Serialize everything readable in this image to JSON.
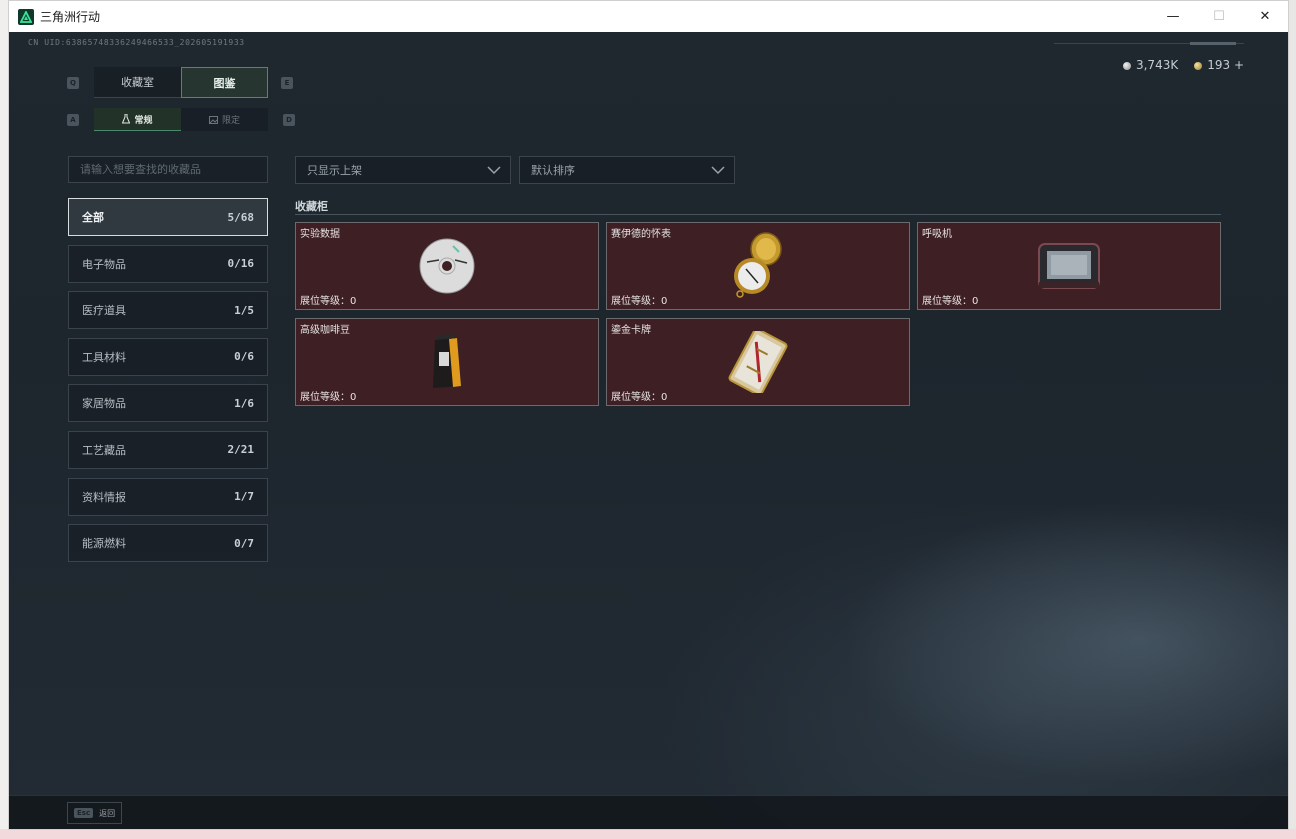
{
  "window": {
    "title": "三角洲行动",
    "minimize_glyph": "—",
    "maximize_glyph": "☐",
    "close_glyph": "✕"
  },
  "header": {
    "uid": "CN UID:63865748336249466533_202605191933",
    "silver_amount": "3,743K",
    "gold_amount": "193 +"
  },
  "tabs": {
    "prev_key": "Q",
    "next_key": "E",
    "items": [
      {
        "label": "收藏室",
        "active": false
      },
      {
        "label": "图鉴",
        "active": true
      }
    ]
  },
  "subtabs": {
    "prev_key": "A",
    "next_key": "D",
    "items": [
      {
        "label": "常规",
        "icon": "flask-icon",
        "active": true
      },
      {
        "label": "限定",
        "icon": "image-icon",
        "active": false
      }
    ]
  },
  "search": {
    "placeholder": "请输入想要查找的收藏品"
  },
  "categories": [
    {
      "label": "全部",
      "count": "5/68",
      "active": true
    },
    {
      "label": "电子物品",
      "count": "0/16",
      "active": false
    },
    {
      "label": "医疗道具",
      "count": "1/5",
      "active": false
    },
    {
      "label": "工具材料",
      "count": "0/6",
      "active": false
    },
    {
      "label": "家居物品",
      "count": "1/6",
      "active": false
    },
    {
      "label": "工艺藏品",
      "count": "2/21",
      "active": false
    },
    {
      "label": "资料情报",
      "count": "1/7",
      "active": false
    },
    {
      "label": "能源燃料",
      "count": "0/7",
      "active": false
    }
  ],
  "filters": {
    "shelf_filter": "只显示上架",
    "sort": "默认排序"
  },
  "cabinet": {
    "title": "收藏柜",
    "items": [
      {
        "name": "实验数据",
        "level": "展位等级：0",
        "icon": "disc-icon"
      },
      {
        "name": "赛伊德的怀表",
        "level": "展位等级：0",
        "icon": "pocket-watch-icon"
      },
      {
        "name": "呼吸机",
        "level": "展位等级：0",
        "icon": "ventilator-icon"
      },
      {
        "name": "高级咖啡豆",
        "level": "展位等级：0",
        "icon": "coffee-bag-icon"
      },
      {
        "name": "鎏金卡牌",
        "level": "展位等级：0",
        "icon": "gilded-card-icon"
      }
    ]
  },
  "footer": {
    "esc_key": "Esc",
    "back_label": "返回"
  },
  "colors": {
    "accent_green": "#4c8a6c",
    "card_background": "#3d1f24",
    "window_background": "#1b2229"
  }
}
